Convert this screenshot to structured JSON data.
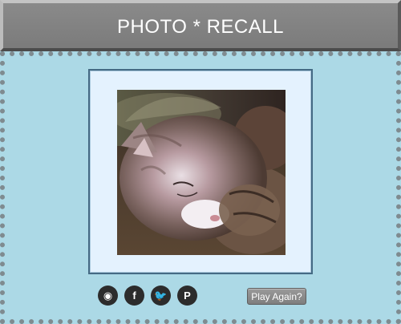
{
  "header": {
    "title": "PHOTO * RECALL"
  },
  "photo": {
    "subject": "sleeping-cat-photo"
  },
  "share": {
    "buttons": [
      {
        "icon": "instagram-icon",
        "glyph": "◉"
      },
      {
        "icon": "facebook-icon",
        "glyph": "f"
      },
      {
        "icon": "twitter-icon",
        "glyph": "🐦"
      },
      {
        "icon": "pinterest-icon",
        "glyph": "P"
      }
    ]
  },
  "actions": {
    "play_again_label": "Play Again?"
  },
  "colors": {
    "title_bar": "#808080",
    "board_background": "#acd9e6",
    "board_dots": "#7f8b90",
    "frame_background": "#e4f2fe",
    "frame_border": "#456a84",
    "share_button": "#2c2c2c",
    "play_button": "#8c8c8c"
  }
}
